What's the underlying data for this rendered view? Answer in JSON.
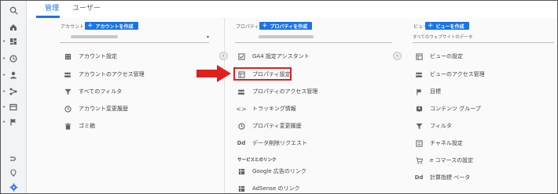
{
  "tabs": {
    "admin": "管理",
    "user": "ユーザー"
  },
  "account": {
    "header": "アカウント",
    "create_label": "アカウントを作成",
    "items": [
      {
        "label": "アカウント設定",
        "icon": "building-icon"
      },
      {
        "label": "アカウントのアクセス管理",
        "icon": "people-icon"
      },
      {
        "label": "すべてのフィルタ",
        "icon": "filter-icon"
      },
      {
        "label": "アカウント変更履歴",
        "icon": "history-icon"
      },
      {
        "label": "ゴミ箱",
        "icon": "trash-icon"
      }
    ]
  },
  "property": {
    "header": "プロパティ",
    "create_label": "プロパティを作成",
    "items": [
      {
        "label": "GA4 設定アシスタント",
        "icon": "checkbox-icon"
      },
      {
        "label": "プロパティ設定",
        "icon": "page-icon"
      },
      {
        "label": "プロパティのアクセス管理",
        "icon": "people-icon"
      },
      {
        "label": "トラッキング情報",
        "icon": "code-icon"
      },
      {
        "label": "プロパティ変更履歴",
        "icon": "history-icon"
      },
      {
        "label": "データ削除リクエスト",
        "icon": "dd-icon"
      }
    ],
    "services_header": "サービスとのリンク",
    "services": [
      {
        "label": "Google 広告のリンク",
        "icon": "table-icon"
      },
      {
        "label": "AdSense のリンク",
        "icon": "table-icon"
      }
    ]
  },
  "view": {
    "header": "ビュー",
    "create_label": "ビューを作成",
    "selector_value": "すべてのウェブサイトのデータ",
    "items": [
      {
        "label": "ビューの設定",
        "icon": "page-icon"
      },
      {
        "label": "ビューのアクセス管理",
        "icon": "people-icon"
      },
      {
        "label": "目標",
        "icon": "flag-icon"
      },
      {
        "label": "コンテンツ グループ",
        "icon": "person-pin-icon"
      },
      {
        "label": "フィルタ",
        "icon": "filter-icon"
      },
      {
        "label": "チャネル設定",
        "icon": "channel-icon"
      },
      {
        "label": "e コマースの設定",
        "icon": "cart-icon"
      },
      {
        "label": "計算指標 ベータ",
        "icon": "dd-icon"
      }
    ]
  },
  "colors": {
    "accent": "#1a73e8",
    "highlight": "#e02020"
  }
}
